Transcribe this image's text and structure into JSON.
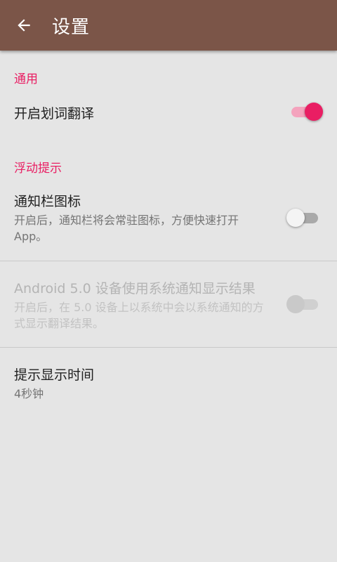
{
  "appbar": {
    "title": "设置",
    "back_icon": "arrow-left-icon"
  },
  "colors": {
    "appbar": "#7b5548",
    "accent": "#e91e63",
    "background": "#e5e5e5"
  },
  "sections": {
    "general": {
      "header": "通用",
      "toggle_translate": {
        "title": "开启划词翻译",
        "enabled": true
      }
    },
    "float": {
      "header": "浮动提示",
      "notification_icon": {
        "title": "通知栏图标",
        "summary": "开启后，通知栏将会常驻图标，方便快速打开App。",
        "enabled": false
      },
      "android5": {
        "title": "Android 5.0 设备使用系统通知显示结果",
        "summary": "开启后，在 5.0 设备上以系统中会以系统通知的方式显示翻译结果。",
        "enabled": false,
        "disabled": true
      },
      "duration": {
        "title": "提示显示时间",
        "summary": "4秒钟"
      }
    }
  }
}
